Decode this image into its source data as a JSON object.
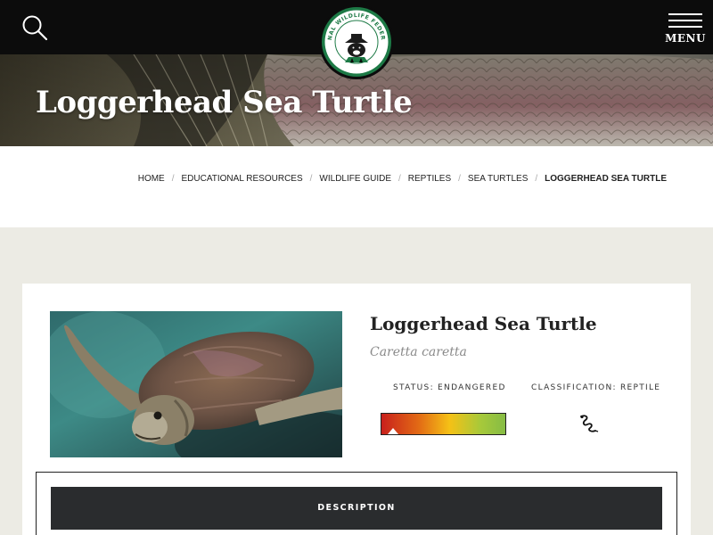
{
  "header": {
    "search_icon": "search-icon",
    "menu_label": "MENU",
    "menu_icon": "hamburger-icon",
    "logo_text": "NATIONAL WILDLIFE FEDERATION"
  },
  "hero": {
    "title": "Loggerhead Sea Turtle"
  },
  "breadcrumb": {
    "items": [
      "HOME",
      "EDUCATIONAL RESOURCES",
      "WILDLIFE GUIDE",
      "REPTILES",
      "SEA TURTLES"
    ],
    "current": "LOGGERHEAD SEA TURTLE",
    "separator": "/"
  },
  "species": {
    "common_name": "Loggerhead Sea Turtle",
    "scientific_name": "Caretta caretta",
    "status_label": "STATUS: ENDANGERED",
    "status_level": 0.05,
    "classification_label": "CLASSIFICATION: REPTILE",
    "classification_icon": "snake-icon"
  },
  "tabs": {
    "description_label": "DESCRIPTION"
  },
  "colors": {
    "topbar": "#0c0c0c",
    "page_background": "#ecebe4",
    "tab_background": "#2a2c2e",
    "logo_green": "#1d7a46",
    "status_red": "#c8201c",
    "status_yellow": "#f5c116",
    "status_green": "#86bc45"
  }
}
